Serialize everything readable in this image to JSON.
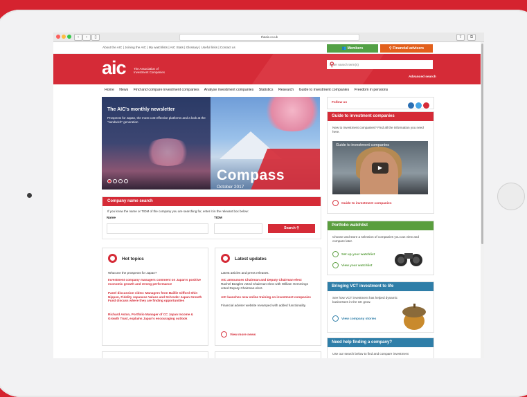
{
  "browser": {
    "url": "theaic.co.uk"
  },
  "utility_links": "About the AIC | Joining the AIC | My watchlists | AIC Stats | Glossary | Useful links | Contact us",
  "members_label": "Members",
  "fa_label": "Financial advisers",
  "logo": {
    "text": "aic",
    "sub_line1": "The Association of",
    "sub_line2": "Investment Companies"
  },
  "search": {
    "placeholder": "Enter search term(s)",
    "advanced": "Advanced search"
  },
  "nav": [
    "Home",
    "News",
    "Find and compare investment companies",
    "Analyse investment companies",
    "Statistics",
    "Research",
    "Guide to investment companies",
    "Freedom in pensions"
  ],
  "hero": {
    "title": "The AIC's monthly newsletter",
    "subtitle": "Prospects for Japan, the most cost-effective platforms and a look at the \"sandwich\" generation",
    "brand": "Compass",
    "date": "October 2017"
  },
  "company_search": {
    "title": "Company name search",
    "help": "If you know the name or TIDM of the company you are searching for, enter it in the relevant box below:",
    "name_label": "Name",
    "tidm_label": "TIDM",
    "button": "Search"
  },
  "hot_topics": {
    "title": "Hot topics",
    "intro": "What are the prospects for Japan?",
    "items": [
      "Investment company managers comment on Japan's positive economic growth and strong performance",
      "Panel discussion video: Managers from Baillie Gifford Shin Nippon, Fidelity Japanese Values and Schroder Japan Growth Fund discuss where they are finding opportunities",
      "Richard Aston, Portfolio Manager of CC Japan Income & Growth Trust, explains Japan's encouraging outlook"
    ]
  },
  "latest_updates": {
    "title": "Latest updates",
    "intro": "Latest articles and press releases.",
    "item1_link": "AIC announces Chairman and Deputy Chairman-elect",
    "item1_text": "Rachel Beagles voted Chairman-elect with William Hemmings voted Deputy Chairman-elect.",
    "item2_link": "AIC launches new online training on investment companies",
    "item2_text": "Financial adviser website revamped with added functionality.",
    "more": "View more news"
  },
  "follow": {
    "label": "Follow us"
  },
  "guide": {
    "title": "Guide to investment companies",
    "text": "New to investment companies? Find all the information you need here.",
    "video_title": "Guide to investment companies",
    "link": "Guide to investment companies"
  },
  "watchlist": {
    "title": "Portfolio watchlist",
    "text": "Choose and store a selection of companies you can view and compare later.",
    "link1": "Set up your watchlist",
    "link2": "View your watchlist"
  },
  "vct": {
    "title": "Bringing VCT investment to life",
    "text": "See how VCT investment has helped dynamic businesses in the UK grow.",
    "link": "View company stories"
  },
  "help": {
    "title": "Need help finding a company?",
    "text": "Use our search below to find and compare investment"
  },
  "colors": {
    "brand_red": "#d52b37",
    "members_green": "#53a145",
    "fa_orange": "#e2601c",
    "watchlist_green": "#5a9e3e",
    "vct_blue": "#2f7ea8"
  }
}
